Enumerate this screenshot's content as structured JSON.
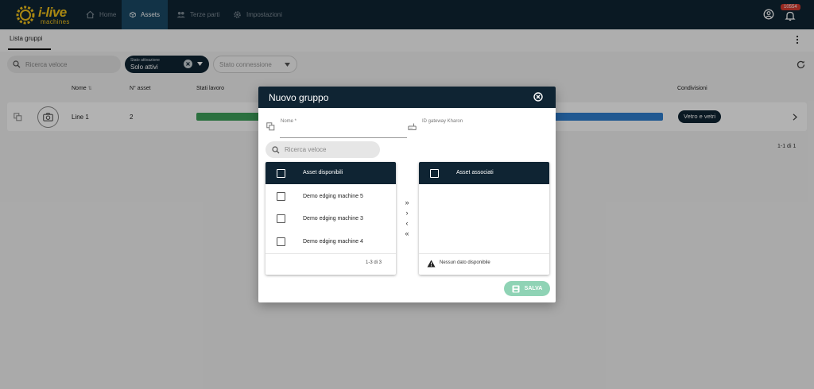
{
  "app": {
    "logo_text": "i-live",
    "logo_subtext": "machines",
    "nav": [
      {
        "label": "Home",
        "icon": "home-icon"
      },
      {
        "label": "Assets",
        "icon": "cube-icon"
      },
      {
        "label": "Terze parti",
        "icon": "people-icon"
      },
      {
        "label": "Impostazioni",
        "icon": "gear-icon"
      }
    ],
    "notification_count": "10554"
  },
  "subheader": {
    "tab": "Lista gruppi"
  },
  "filters": {
    "search_placeholder": "Ricerca veloce",
    "activation": {
      "label": "Stato attivazione",
      "value": "Solo attivi"
    },
    "connection_placeholder": "Stato connessione"
  },
  "table": {
    "headers": {
      "name": "Nome",
      "asset_count": "N° asset",
      "work_states": "Stati lavoro",
      "conditions": "Condivisioni"
    },
    "rows": [
      {
        "name": "Line 1",
        "asset_count": "2",
        "condition": "Vetro e vetri"
      }
    ],
    "pagination": "1-1 di 1"
  },
  "dialog": {
    "title": "Nuovo gruppo",
    "name_label": "Nome *",
    "gateway_label": "ID gateway Kharon",
    "search_placeholder": "Ricerca veloce",
    "available": {
      "title": "Asset disponibili",
      "items": [
        "Demo edging machine 5",
        "Demo edging machine 3",
        "Demo edging machine 4"
      ],
      "pagination": "1-3 di 3"
    },
    "associated": {
      "title": "Asset associati",
      "empty_text": "Nessun dato disponibile"
    },
    "transfer_buttons": [
      "»",
      "›",
      "‹",
      "«"
    ],
    "save_label": "SALVA"
  },
  "colors": {
    "navy": "#0f2433",
    "active_nav": "#1b4a66",
    "brand_yellow": "#f2c21b",
    "save_green": "#8fd3b5",
    "bar_green": "#3ea15b",
    "bar_blue": "#2f7fd0"
  }
}
